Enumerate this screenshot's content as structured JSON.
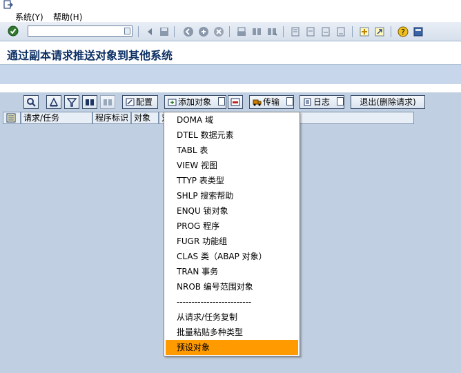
{
  "menubar": {
    "items": [
      "系统(Y)",
      "帮助(H)"
    ]
  },
  "toolbar": {
    "command_value": "",
    "icons": [
      "enter-icon",
      "save-icon",
      "back-icon",
      "exit-icon",
      "cancel-icon",
      "print-icon",
      "find-icon",
      "find-next-icon",
      "first-page-icon",
      "prev-page-icon",
      "next-page-icon",
      "last-page-icon",
      "new-session-icon",
      "shortcut-icon",
      "help-icon",
      "layout-icon"
    ]
  },
  "title": "通过副本请求推送对象到其他系统",
  "app_toolbar": {
    "config_label": "配置",
    "add_object_label": "添加对象",
    "transport_label": "传输",
    "log_label": "日志",
    "exit_label": "退出(删除请求)"
  },
  "table": {
    "columns": [
      "请求/任务",
      "程序标识",
      "对象",
      "对"
    ]
  },
  "dropdown": {
    "items": [
      "DOMA 域",
      "DTEL 数据元素",
      "TABL 表",
      "VIEW 视图",
      "TTYP 表类型",
      "SHLP 搜索帮助",
      "ENQU 锁对象",
      "PROG 程序",
      "FUGR 功能组",
      "CLAS 类（ABAP 对象）",
      "TRAN 事务",
      "NROB 编号范围对象",
      "-------------------------",
      "从请求/任务复制",
      "批量粘贴多种类型",
      "预设对象"
    ],
    "highlighted_index": 15
  },
  "colors": {
    "highlight": "#ff9a00",
    "title": "#0c2f64",
    "background": "#c0cfe1"
  }
}
